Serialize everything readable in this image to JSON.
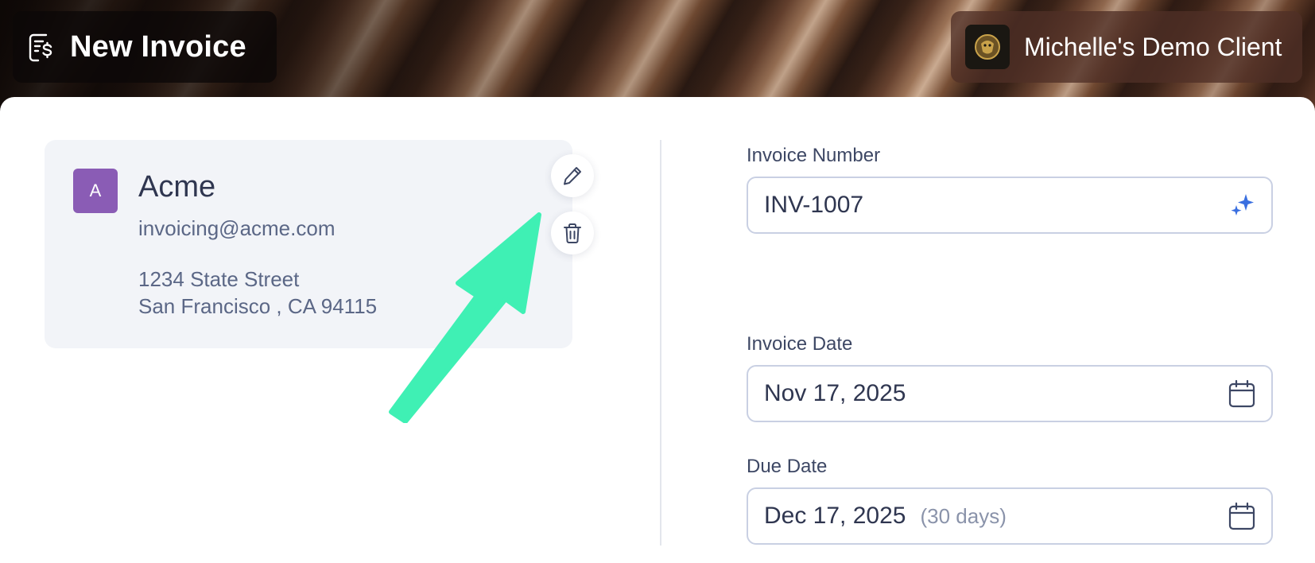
{
  "header": {
    "title": "New Invoice",
    "title_icon": "invoice-dollar-icon",
    "client_name": "Michelle's Demo Client",
    "client_logo": "client-logo"
  },
  "customer": {
    "avatar_letter": "A",
    "name": "Acme",
    "email": "invoicing@acme.com",
    "address_line1": "1234 State Street",
    "address_line2": "San Francisco , CA 94115",
    "avatar_color": "#8a5cb5",
    "edit_icon": "pencil-icon",
    "delete_icon": "trash-icon"
  },
  "form": {
    "invoice_number": {
      "label": "Invoice Number",
      "value": "INV-1007",
      "icon": "sparkle-icon"
    },
    "invoice_date": {
      "label": "Invoice Date",
      "value": "Nov 17, 2025",
      "icon": "calendar-icon"
    },
    "due_date": {
      "label": "Due Date",
      "value": "Dec 17, 2025",
      "hint": "(30 days)",
      "icon": "calendar-icon"
    }
  },
  "annotation": {
    "arrow_color": "#3ff0b4"
  }
}
